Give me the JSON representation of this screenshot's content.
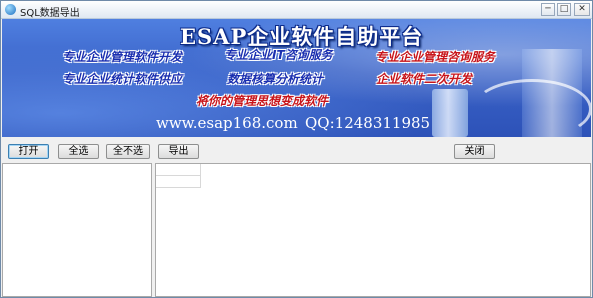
{
  "window": {
    "title": "SQL数据导出",
    "caption_buttons": {
      "minimize": "─",
      "maximize": "□",
      "close": "✕"
    }
  },
  "banner": {
    "title": "ESAP企业软件自助平台",
    "services": [
      "专业企业管理软件开发",
      "专业企业IT咨询服务",
      "专业企业管理咨询服务",
      "专业企业统计软件供应",
      "数据核算分析统计",
      "企业软件二次开发"
    ],
    "slogan": "将你的管理思想变成软件",
    "website": "www.esap168.com",
    "qq": "QQ:1248311985",
    "colors": {
      "accent": "#c8141a",
      "primary": "#1a2fb0",
      "background": "#3a63c8"
    }
  },
  "toolbar": {
    "open_label": "打开",
    "select_all_label": "全选",
    "select_none_label": "全不选",
    "export_label": "导出",
    "close_label": "关闭"
  }
}
